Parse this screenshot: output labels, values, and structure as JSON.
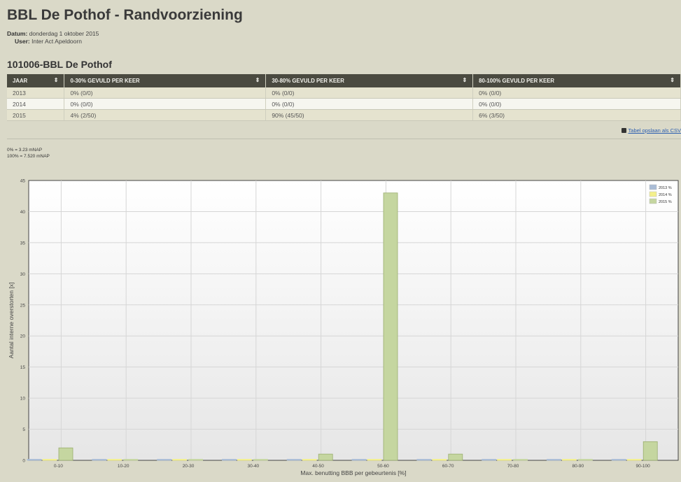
{
  "page": {
    "title": "BBL De Pothof - Randvoorziening",
    "datum_label": "Datum:",
    "datum_value": "donderdag 1 oktober 2015",
    "user_label": "User:",
    "user_value": "Inter Act Apeldoorn",
    "section_title": "101006-BBL De Pothof"
  },
  "table": {
    "headers": [
      "JAAR",
      "0-30% GEVULD PER KEER",
      "30-80% GEVULD PER KEER",
      "80-100% GEVULD PER KEER"
    ],
    "sort_icon": "⇕",
    "rows": [
      [
        "2013",
        "0% (0/0)",
        "0% (0/0)",
        "0% (0/0)"
      ],
      [
        "2014",
        "0% (0/0)",
        "0% (0/0)",
        "0% (0/0)"
      ],
      [
        "2015",
        "4% (2/50)",
        "90% (45/50)",
        "6% (3/50)"
      ]
    ],
    "csv_link": "Tabel opslaan als CSV"
  },
  "scale_note": {
    "line1": "0% = 3.23 mNAP",
    "line2": "100% = 7.520 mNAP"
  },
  "chart_data": {
    "type": "bar",
    "categories": [
      "0-10",
      "10-20",
      "20-30",
      "30-40",
      "40-50",
      "50-60",
      "60-70",
      "70-80",
      "80-90",
      "90-100"
    ],
    "series": [
      {
        "name": "2013 %",
        "color": "#a9bcd6",
        "values": [
          0,
          0,
          0,
          0,
          0,
          0,
          0,
          0,
          0,
          0
        ]
      },
      {
        "name": "2014 %",
        "color": "#f4f08c",
        "values": [
          0,
          0,
          0,
          0,
          0,
          0,
          0,
          0,
          0,
          0
        ]
      },
      {
        "name": "2015 %",
        "color": "#c5d6a0",
        "values": [
          2,
          0,
          0,
          0,
          1,
          43,
          1,
          0,
          0,
          3
        ]
      }
    ],
    "xlabel": "Max. benutting BBB per gebeurtenis [%]",
    "ylabel": "Aantal interne overstorten [x]",
    "ylim": [
      0,
      45
    ],
    "yticks": [
      0,
      5,
      10,
      15,
      20,
      25,
      30,
      35,
      40,
      45
    ],
    "grid": true,
    "legend": "top-right"
  }
}
